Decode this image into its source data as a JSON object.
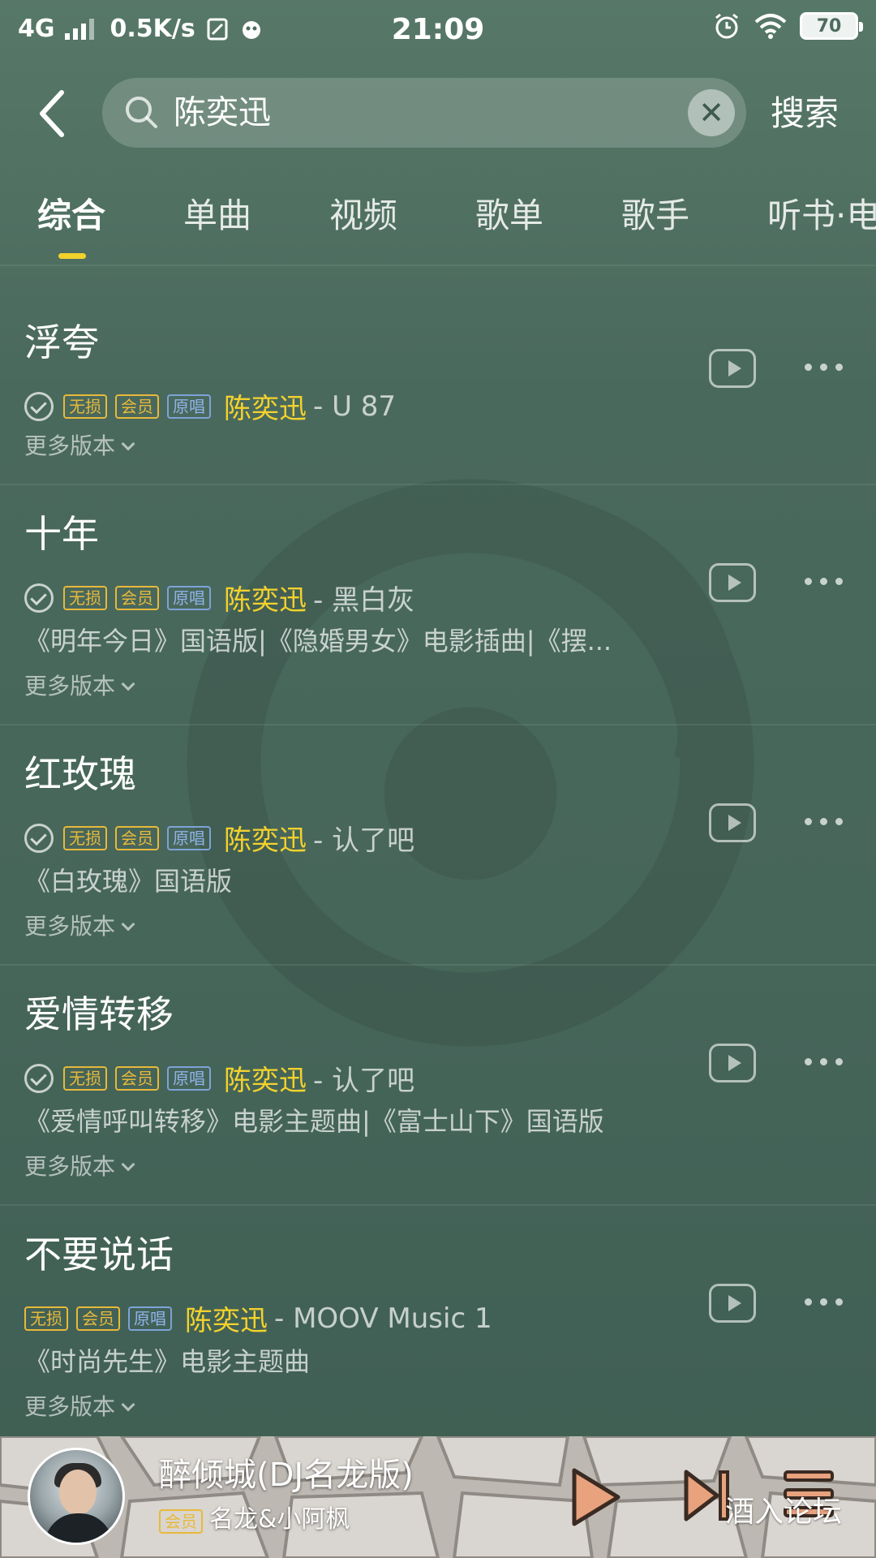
{
  "status_bar": {
    "network": "4G",
    "speed": "0.5K/s",
    "time": "21:09",
    "battery": "70"
  },
  "search": {
    "query": "陈奕迅",
    "button_label": "搜索"
  },
  "tabs": [
    "综合",
    "单曲",
    "视频",
    "歌单",
    "歌手",
    "听书·电"
  ],
  "badges": {
    "lossless": "无损",
    "vip": "会员",
    "original": "原唱"
  },
  "more_versions": "更多版本",
  "songs": [
    {
      "title": "浮夸",
      "artist": "陈奕迅",
      "album": "- U 87",
      "desc": ""
    },
    {
      "title": "十年",
      "artist": "陈奕迅",
      "album": "- 黑白灰",
      "desc": "《明年今日》国语版|《隐婚男女》电影插曲|《摆..."
    },
    {
      "title": "红玫瑰",
      "artist": "陈奕迅",
      "album": "- 认了吧",
      "desc": "《白玫瑰》国语版"
    },
    {
      "title": "爱情转移",
      "artist": "陈奕迅",
      "album": "- 认了吧",
      "desc": "《爱情呼叫转移》电影主题曲|《富士山下》国语版"
    },
    {
      "title": "不要说话",
      "artist": "陈奕迅",
      "album": "- MOOV Music 1",
      "desc": "《时尚先生》电影主题曲"
    }
  ],
  "player": {
    "song": "醉倾城(DJ名龙版)",
    "vip_badge": "会员",
    "singer": "名龙&小阿枫"
  },
  "forum_watermark": "酒入论坛",
  "colors": {
    "accent": "#f3d22c",
    "badge_gold": "#e8b93a",
    "badge_blue": "#8eb4ea",
    "background": "#4c6b5e"
  },
  "icons": [
    "back-arrow-icon",
    "search-icon",
    "clear-icon",
    "check-circle-icon",
    "mv-play-icon",
    "more-dots-icon",
    "play-icon",
    "next-icon",
    "playlist-icon"
  ]
}
